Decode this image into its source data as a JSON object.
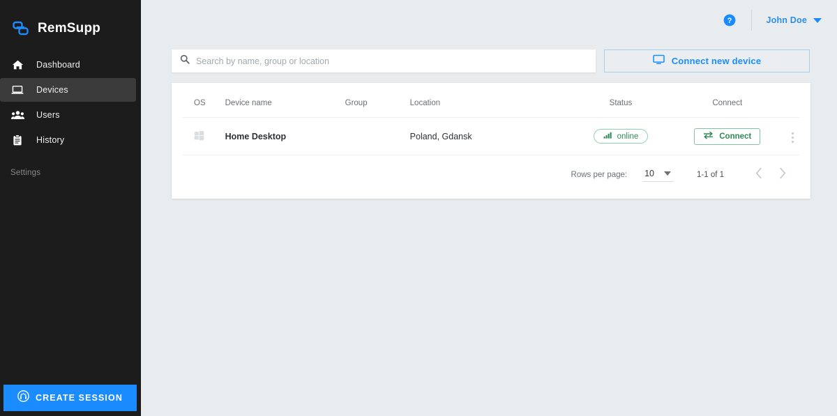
{
  "brand": {
    "name": "RemSupp",
    "logo_icon": "link-chain-icon",
    "accent": "#1a8cff"
  },
  "sidebar": {
    "items": [
      {
        "label": "Dashboard",
        "icon": "home-icon",
        "active": false
      },
      {
        "label": "Devices",
        "icon": "laptop-icon",
        "active": true
      },
      {
        "label": "Users",
        "icon": "people-icon",
        "active": false
      },
      {
        "label": "History",
        "icon": "clipboard-icon",
        "active": false
      }
    ],
    "section_label": "Settings",
    "create_session": {
      "label": "CREATE SESSION",
      "icon": "headset-icon",
      "color": "#1a8cff"
    }
  },
  "topbar": {
    "help_icon": "help-circle-icon",
    "user_name": "John Doe",
    "caret_icon": "chevron-down-icon"
  },
  "toolbar": {
    "search": {
      "placeholder": "Search by name, group or location",
      "value": "",
      "icon": "search-icon"
    },
    "connect_new_device": {
      "label": "Connect new device",
      "icon": "monitor-icon"
    }
  },
  "table": {
    "columns": [
      "OS",
      "Device name",
      "Group",
      "Location",
      "Status",
      "Connect",
      ""
    ],
    "rows": [
      {
        "os_icon": "windows-icon",
        "device_name": "Home Desktop",
        "group": "",
        "location": "Poland, Gdansk",
        "status": {
          "label": "online",
          "icon": "signal-bars-icon",
          "color": "#2e8b57"
        },
        "connect": {
          "label": "Connect",
          "icon": "transfer-arrows-icon"
        },
        "more_icon": "kebab-menu-icon"
      }
    ]
  },
  "pagination": {
    "rows_per_page_label": "Rows per page:",
    "rows_per_page_value": "10",
    "range_label": "1-1 of 1",
    "prev_icon": "chevron-left-icon",
    "next_icon": "chevron-right-icon"
  }
}
